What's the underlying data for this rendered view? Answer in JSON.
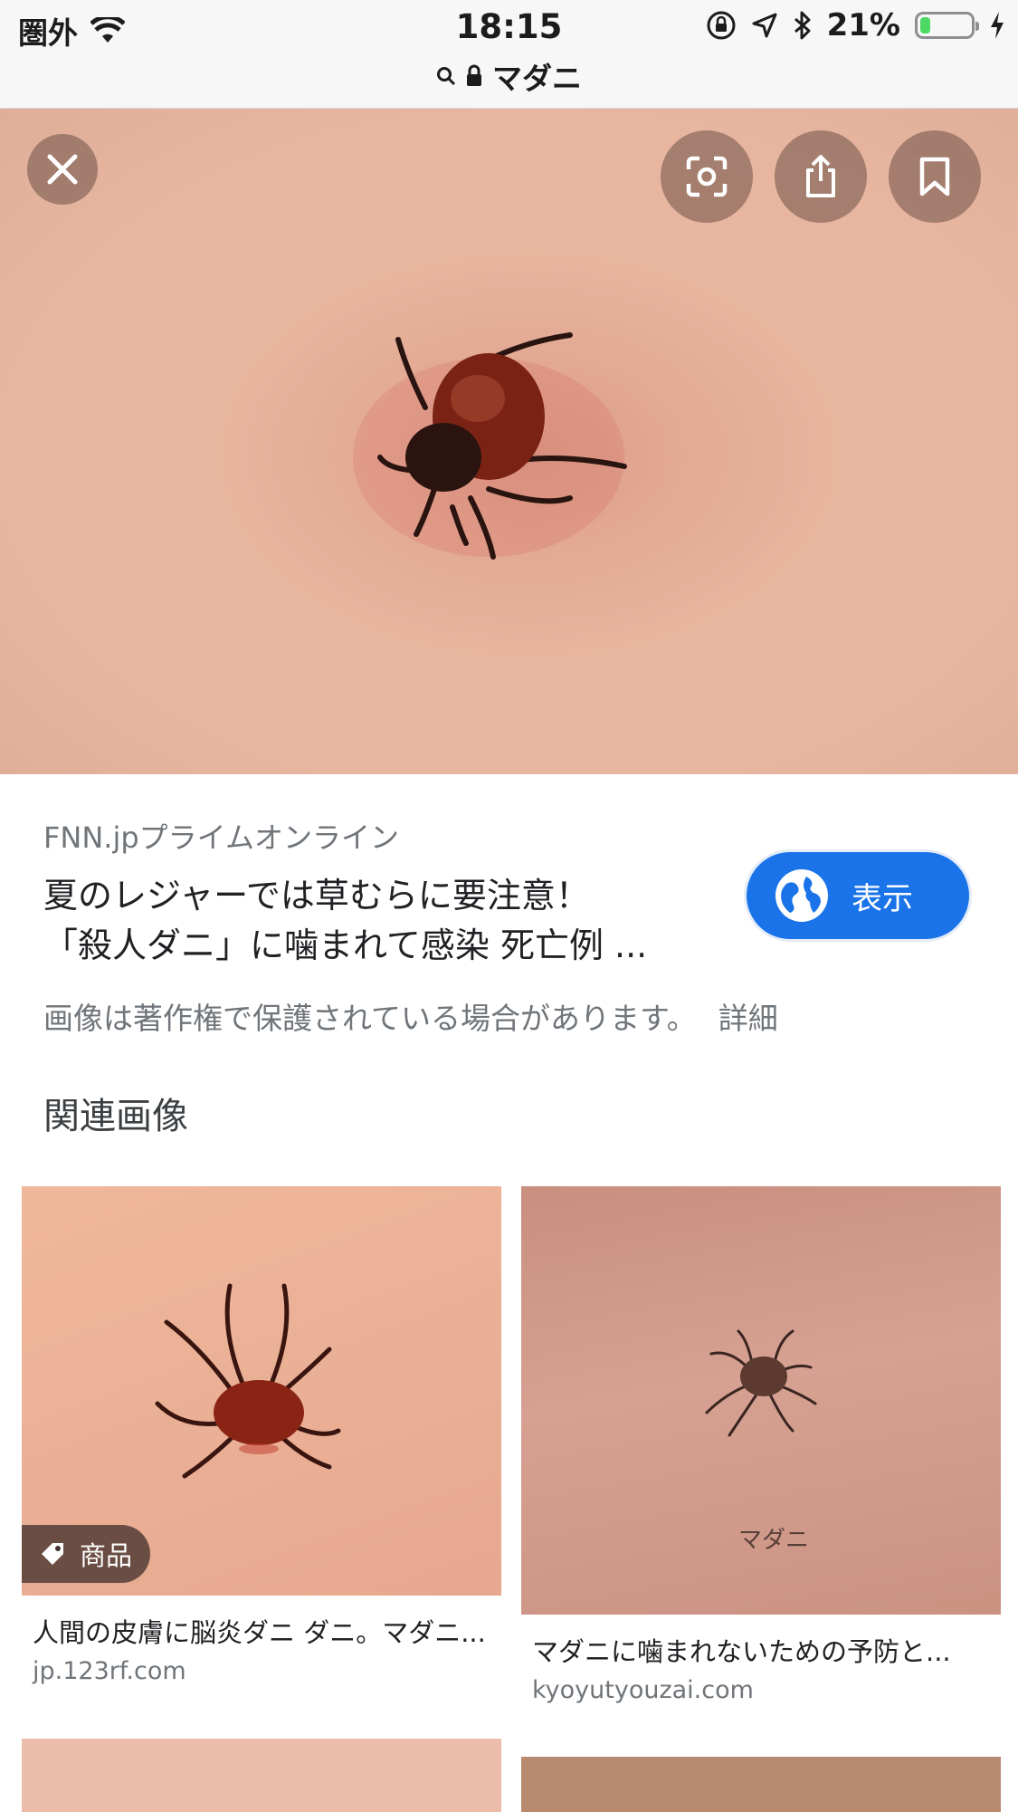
{
  "status_bar": {
    "carrier": "圏外",
    "time": "18:15",
    "battery": "21%",
    "battery_level": 0.21
  },
  "url_bar": {
    "query": "マダニ"
  },
  "hero": {
    "icons": [
      "close-icon",
      "lens-icon",
      "share-icon",
      "bookmark-icon"
    ]
  },
  "result": {
    "source": "FNN.jpプライムオンライン",
    "title_line1": "夏のレジャーでは草むらに要注意！",
    "title_line2": "「殺人ダニ」に噛まれて感染 死亡例 ...",
    "visit_label": "表示",
    "copyright_notice": "画像は著作権で保護されている場合があります。",
    "detail_link": "詳細"
  },
  "related": {
    "heading": "関連画像",
    "items": [
      {
        "caption": "人間の皮膚に脳炎ダニ ダニ。マダニ...",
        "domain": "jp.123rf.com",
        "tag": "商品"
      },
      {
        "caption": "マダニに噛まれないための予防と...",
        "domain": "kyoyutyouzai.com",
        "watermark": "マダニ"
      }
    ]
  },
  "colors": {
    "accent": "#1a73e8",
    "battery_green": "#4cd964",
    "secondary_text": "#70757a"
  }
}
